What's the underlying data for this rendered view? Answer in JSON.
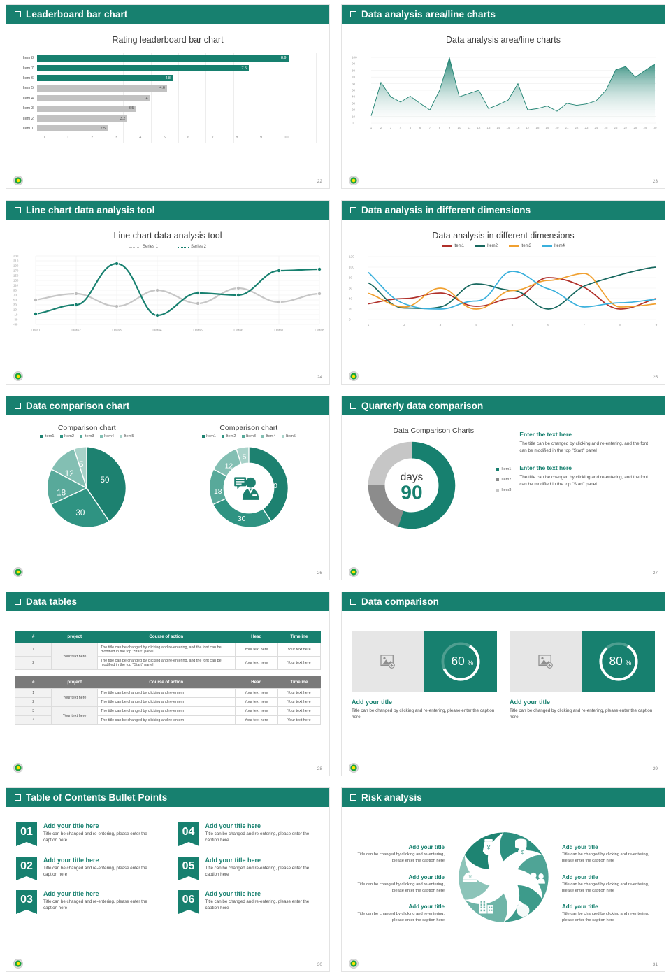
{
  "slides": [
    {
      "header": "Leaderboard bar chart",
      "page": "22",
      "chart_title": "Rating leaderboard bar chart"
    },
    {
      "header": "Data analysis area/line charts",
      "page": "23",
      "chart_title": "Data analysis area/line charts"
    },
    {
      "header": "Line chart data analysis tool",
      "page": "24",
      "chart_title": "Line chart data analysis tool"
    },
    {
      "header": "Data analysis in different dimensions",
      "page": "25",
      "chart_title": "Data analysis in different dimensions"
    },
    {
      "header": "Data comparison chart",
      "page": "26",
      "chart_title": "Comparison chart"
    },
    {
      "header": "Quarterly data comparison",
      "page": "27",
      "chart_title": "Data Comparison Charts"
    },
    {
      "header": "Data tables",
      "page": "28"
    },
    {
      "header": "Data comparison",
      "page": "29"
    },
    {
      "header": "Table of Contents Bullet Points",
      "page": "30"
    },
    {
      "header": "Risk analysis",
      "page": "31"
    }
  ],
  "colors": {
    "brand_green": "#17806f",
    "gray_bar": "#c2c2c2",
    "header_gray": "#7a7a7a",
    "item1_red": "#b0302a",
    "item2_teal": "#16675e",
    "item3_orange": "#f0a030",
    "item4_blue": "#3ab0dc"
  },
  "chart_data": [
    {
      "type": "bar",
      "title": "Rating leaderboard bar chart",
      "orientation": "horizontal",
      "categories": [
        "Item 1",
        "Item 2",
        "Item 3",
        "Item 4",
        "Item 5",
        "Item 6",
        "Item 7",
        "Item 8"
      ],
      "values": [
        2.5,
        3.2,
        3.5,
        4,
        4.6,
        4.8,
        7.5,
        8.9
      ],
      "labels": [
        "2.5",
        "3.2",
        "3.5",
        "4",
        "4.6",
        "4.8",
        "7.5",
        "8.9"
      ],
      "highlighted": [
        "Item 6",
        "Item 7",
        "Item 8"
      ],
      "xlim": [
        0,
        10
      ],
      "xticks": [
        "0",
        "1",
        "2",
        "3",
        "4",
        "5",
        "6",
        "7",
        "8",
        "9",
        "10"
      ],
      "xlabel": "",
      "ylabel": "",
      "grid": true
    },
    {
      "type": "area",
      "title": "Data analysis area/line charts",
      "x": [
        1,
        2,
        3,
        4,
        5,
        6,
        7,
        8,
        9,
        10,
        11,
        12,
        13,
        14,
        15,
        16,
        17,
        18,
        19,
        20,
        21,
        22,
        23,
        24,
        25,
        26,
        27,
        28,
        29,
        30
      ],
      "values": [
        11,
        62,
        40,
        32,
        41,
        30,
        20,
        50,
        80,
        40,
        45,
        50,
        22,
        28,
        35,
        60,
        20,
        22,
        26,
        18,
        30,
        27,
        29,
        34,
        50,
        81,
        86,
        70,
        80,
        90
      ],
      "ylim": [
        0,
        100
      ],
      "yticks": [
        "0",
        "10",
        "20",
        "30",
        "40",
        "50",
        "60",
        "70",
        "80",
        "90",
        "100"
      ],
      "xticks": [
        "1",
        "2",
        "3",
        "4",
        "5",
        "6",
        "7",
        "8",
        "9",
        "10",
        "11",
        "12",
        "13",
        "14",
        "15",
        "16",
        "17",
        "18",
        "19",
        "20",
        "21",
        "22",
        "23",
        "24",
        "25",
        "26",
        "27",
        "28",
        "29",
        "30"
      ],
      "grid": true
    },
    {
      "type": "line",
      "title": "Line chart data analysis tool",
      "categories": [
        "Data1",
        "Data2",
        "Data3",
        "Data4",
        "Data5",
        "Data6",
        "Data7",
        "Data8"
      ],
      "series": [
        {
          "name": "Series 1",
          "values": [
            50,
            75,
            30,
            90,
            35,
            95,
            37,
            75
          ],
          "color": "#bcbcbc"
        },
        {
          "name": "Series 2",
          "values": [
            -5,
            50,
            195,
            -8,
            78,
            70,
            175,
            180
          ],
          "color": "#17806f"
        }
      ],
      "ylim": [
        -30,
        230
      ],
      "yticks": [
        "230",
        "210",
        "190",
        "170",
        "150",
        "130",
        "110",
        "90",
        "70",
        "50",
        "30",
        "10",
        "-10",
        "-30",
        "-50"
      ],
      "legend_position": "top",
      "grid": true
    },
    {
      "type": "line",
      "title": "Data analysis in different dimensions",
      "x": [
        1,
        2,
        3,
        4,
        5,
        6,
        7,
        8,
        9
      ],
      "series": [
        {
          "name": "Item1",
          "values": [
            30,
            38,
            50,
            25,
            40,
            80,
            62,
            25,
            50
          ],
          "color": "#b0302a"
        },
        {
          "name": "Item2",
          "values": [
            70,
            42,
            21,
            32,
            68,
            52,
            20,
            55,
            87
          ],
          "color": "#16675e"
        },
        {
          "name": "Item3",
          "values": [
            50,
            36,
            25,
            60,
            20,
            55,
            79,
            101,
            30
          ],
          "color": "#f0a030"
        },
        {
          "name": "Item4",
          "values": [
            90,
            62,
            40,
            20,
            35,
            91,
            65,
            29,
            38
          ],
          "color": "#3ab0dc"
        }
      ],
      "ylim": [
        0,
        120
      ],
      "yticks": [
        "0",
        "20",
        "40",
        "60",
        "80",
        "100",
        "120"
      ],
      "xticks": [
        "1",
        "2",
        "3",
        "4",
        "5",
        "6",
        "7",
        "8",
        "9"
      ],
      "legend_position": "top",
      "grid": true
    },
    {
      "type": "pie",
      "title": "Comparison chart",
      "labels": [
        "Item1",
        "Item2",
        "Item3",
        "Item4",
        "Item5"
      ],
      "values": [
        50,
        30,
        18,
        12,
        5
      ],
      "data_labels": [
        "50",
        "30",
        "18",
        "12",
        "5"
      ],
      "colors": [
        "#1d8170",
        "#2f9382",
        "#58a99a",
        "#83bfb3",
        "#a8d2c9"
      ],
      "legend_position": "top"
    },
    {
      "type": "pie",
      "title": "Comparison chart",
      "variant": "donut",
      "labels": [
        "Item1",
        "Item2",
        "Item3",
        "Item4",
        "Item5"
      ],
      "values": [
        50,
        30,
        18,
        12,
        5
      ],
      "data_labels": [
        "50",
        "30",
        "18",
        "12",
        "5"
      ],
      "colors": [
        "#1d8170",
        "#2f9382",
        "#58a99a",
        "#83bfb3",
        "#a8d2c9"
      ],
      "legend_position": "top"
    },
    {
      "type": "pie",
      "variant": "donut",
      "title": "Data Comparison Charts",
      "labels": [
        "Item1",
        "Item2",
        "Item3"
      ],
      "values": [
        55,
        20,
        25
      ],
      "center_label": "days",
      "center_value": "90",
      "colors": [
        "#17806f",
        "#8c8c8c",
        "#c6c6c6"
      ],
      "legend_position": "right"
    }
  ],
  "bar_slide": {
    "xticks": [
      "0",
      "1",
      "2",
      "3",
      "4",
      "5",
      "6",
      "7",
      "8",
      "9",
      "10"
    ]
  },
  "line_slide": {
    "legend": [
      {
        "label": "Series 1",
        "color": "#bcbcbc"
      },
      {
        "label": "Series 2",
        "color": "#17806f"
      }
    ],
    "xlabels": [
      "Data1",
      "Data2",
      "Data3",
      "Data4",
      "Data5",
      "Data6",
      "Data7",
      "Data8"
    ],
    "ylabels": [
      "230",
      "210",
      "190",
      "170",
      "150",
      "130",
      "110",
      "90",
      "70",
      "50",
      "30",
      "10",
      "-10",
      "-30",
      "-50"
    ]
  },
  "dimensions_slide": {
    "legend": [
      {
        "label": "Item1",
        "color": "#b0302a"
      },
      {
        "label": "Item2",
        "color": "#16675e"
      },
      {
        "label": "Item3",
        "color": "#f0a030"
      },
      {
        "label": "Item4",
        "color": "#3ab0dc"
      }
    ],
    "ylabels": [
      "120",
      "100",
      "80",
      "60",
      "40",
      "20",
      "0"
    ],
    "xlabels": [
      "1",
      "2",
      "3",
      "4",
      "5",
      "6",
      "7",
      "8",
      "9"
    ]
  },
  "pie_slide": {
    "legend": [
      "Item1",
      "Item2",
      "Item3",
      "Item4",
      "Item5"
    ]
  },
  "quarterly": {
    "chart_title": "Data Comparison Charts",
    "center_label": "days",
    "center_value": "90",
    "legend": [
      "Item1",
      "Item2",
      "Item3"
    ],
    "blocks": [
      {
        "heading": "Enter the text here",
        "text": "The title can be changed by clicking and re-entering, and the font can be modified in the top \"Start\" panel"
      },
      {
        "heading": "Enter the text here",
        "text": "The title can be changed by clicking and re-entering, and the font can be modified in the top \"Start\" panel"
      }
    ]
  },
  "tables": {
    "columns": [
      "#",
      "project",
      "Course of action",
      "Head",
      "Timeline"
    ],
    "table1": {
      "rows": [
        {
          "n": "1",
          "project": "Your text here",
          "action": "The title can be changed by clicking and re-entering, and the font can be modified in the top \"Start\" panel",
          "head": "Your text here",
          "timeline": "Your text here"
        },
        {
          "n": "2",
          "project": "",
          "action": "The title can be changed by clicking and re-entering, and the font can be modified in the top \"Start\" panel",
          "head": "Your text here",
          "timeline": "Your text here"
        }
      ]
    },
    "table2": {
      "rows": [
        {
          "n": "1",
          "project": "Your text here",
          "action": "The title can be changed by clicking and re-entern",
          "head": "Your text here",
          "timeline": "Your text here"
        },
        {
          "n": "2",
          "project": "",
          "action": "The title can be changed by clicking and re-entern",
          "head": "Your text here",
          "timeline": "Your text here"
        },
        {
          "n": "3",
          "project": "Your text here",
          "action": "The title can be changed by clicking and re-entern",
          "head": "Your text here",
          "timeline": "Your text here"
        },
        {
          "n": "4",
          "project": "",
          "action": "The title can be changed by clicking and re-entern",
          "head": "Your text here",
          "timeline": "Your text here"
        }
      ]
    }
  },
  "comparison": {
    "cards": [
      {
        "percent": "60",
        "percent_symbol": "%",
        "title": "Add your title",
        "text": "Title can be changed by clicking and re-entering, please enter the caption here"
      },
      {
        "percent": "80",
        "percent_symbol": "%",
        "title": "Add your title",
        "text": "Title can be changed by clicking and re-entering, please enter the caption here"
      }
    ]
  },
  "toc": {
    "left": [
      {
        "num": "01",
        "title": "Add your title here",
        "text": "Title can be changed and re-entering, please enter the caption here"
      },
      {
        "num": "02",
        "title": "Add your title here",
        "text": "Title can be changed and re-entering, please enter the caption here"
      },
      {
        "num": "03",
        "title": "Add your title here",
        "text": "Title can be changed and re-entering, please enter the caption here"
      }
    ],
    "right": [
      {
        "num": "04",
        "title": "Add your title here",
        "text": "Title can be changed and re-entering, please enter the caption here"
      },
      {
        "num": "05",
        "title": "Add your title here",
        "text": "Title can be changed and re-entering, please enter the caption here"
      },
      {
        "num": "06",
        "title": "Add your title here",
        "text": "Title can be changed and re-entering, please enter the caption here"
      }
    ]
  },
  "risk": {
    "left": [
      {
        "title": "Add your title",
        "text": "Title can be changed by clicking and re-entering, please enter the caption here"
      },
      {
        "title": "Add your title",
        "text": "Title can be changed by clicking and re-entering, please enter the caption here"
      },
      {
        "title": "Add your title",
        "text": "Title can be changed by clicking and re-entering, please enter the caption here"
      }
    ],
    "right": [
      {
        "title": "Add your title",
        "text": "Title can be changed by clicking and re-entering, please enter the caption here"
      },
      {
        "title": "Add your title",
        "text": "Title can be changed by clicking and re-entering, please enter the caption here"
      },
      {
        "title": "Add your title",
        "text": "Title can be changed by clicking and re-entering, please enter the caption here"
      }
    ],
    "icons": [
      "money-bag-icon",
      "coins-stack-icon",
      "people-icon",
      "pie-chart-icon",
      "building-icon",
      "piggy-hand-icon"
    ]
  }
}
